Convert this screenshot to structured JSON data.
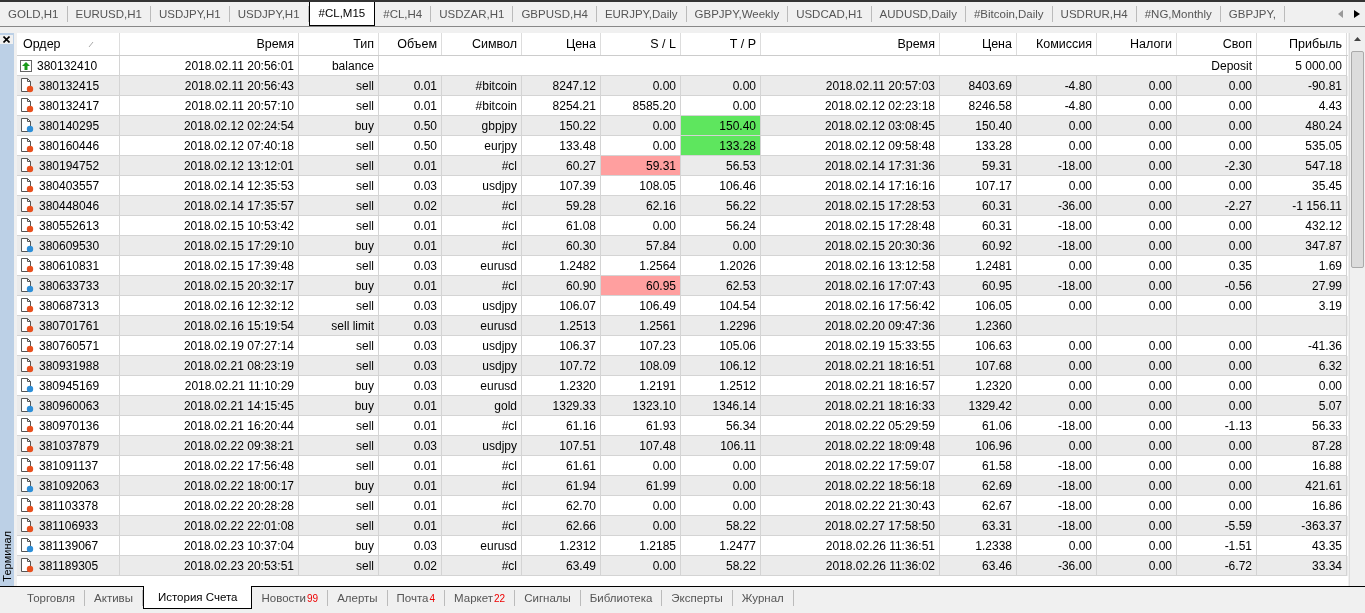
{
  "chart_tabs": [
    {
      "label": "GOLD,H1",
      "selected": false
    },
    {
      "label": "EURUSD,H1",
      "selected": false
    },
    {
      "label": "USDJPY,H1",
      "selected": false
    },
    {
      "label": "USDJPY,H1",
      "selected": false
    },
    {
      "label": "#CL,M15",
      "selected": true
    },
    {
      "label": "#CL,H4",
      "selected": false
    },
    {
      "label": "USDZAR,H1",
      "selected": false
    },
    {
      "label": "GBPUSD,H4",
      "selected": false
    },
    {
      "label": "EURJPY,Daily",
      "selected": false
    },
    {
      "label": "GBPJPY,Weekly",
      "selected": false
    },
    {
      "label": "USDCAD,H1",
      "selected": false
    },
    {
      "label": "AUDUSD,Daily",
      "selected": false
    },
    {
      "label": "#Bitcoin,Daily",
      "selected": false
    },
    {
      "label": "USDRUR,H4",
      "selected": false
    },
    {
      "label": "#NG,Monthly",
      "selected": false
    },
    {
      "label": "GBPJPY,",
      "selected": false
    }
  ],
  "panel_title": "Терминал",
  "columns": [
    "Ордер",
    "Время",
    "Тип",
    "Объем",
    "Символ",
    "Цена",
    "S / L",
    "T / P",
    "Время",
    "Цена",
    "Комиссия",
    "Налоги",
    "Своп",
    "Прибыль"
  ],
  "rows": [
    {
      "kind": "balance",
      "order": "380132410",
      "open_time": "2018.02.11 20:56:01",
      "type": "balance",
      "comment": "Deposit",
      "profit": "5 000.00"
    },
    {
      "kind": "sell",
      "order": "380132415",
      "open_time": "2018.02.11 20:56:43",
      "type": "sell",
      "volume": "0.01",
      "symbol": "#bitcoin",
      "price": "8247.12",
      "sl": "0.00",
      "tp": "0.00",
      "close_time": "2018.02.11 20:57:03",
      "close_price": "8403.69",
      "commission": "-4.80",
      "taxes": "0.00",
      "swap": "0.00",
      "profit": "-90.81",
      "sl_hit": false,
      "tp_hit": false
    },
    {
      "kind": "sell",
      "order": "380132417",
      "open_time": "2018.02.11 20:57:10",
      "type": "sell",
      "volume": "0.01",
      "symbol": "#bitcoin",
      "price": "8254.21",
      "sl": "8585.20",
      "tp": "0.00",
      "close_time": "2018.02.12 02:23:18",
      "close_price": "8246.58",
      "commission": "-4.80",
      "taxes": "0.00",
      "swap": "0.00",
      "profit": "4.43",
      "sl_hit": false,
      "tp_hit": false
    },
    {
      "kind": "buy",
      "order": "380140295",
      "open_time": "2018.02.12 02:24:54",
      "type": "buy",
      "volume": "0.50",
      "symbol": "gbpjpy",
      "price": "150.22",
      "sl": "0.00",
      "tp": "150.40",
      "close_time": "2018.02.12 03:08:45",
      "close_price": "150.40",
      "commission": "0.00",
      "taxes": "0.00",
      "swap": "0.00",
      "profit": "480.24",
      "sl_hit": false,
      "tp_hit": true
    },
    {
      "kind": "sell",
      "order": "380160446",
      "open_time": "2018.02.12 07:40:18",
      "type": "sell",
      "volume": "0.50",
      "symbol": "eurjpy",
      "price": "133.48",
      "sl": "0.00",
      "tp": "133.28",
      "close_time": "2018.02.12 09:58:48",
      "close_price": "133.28",
      "commission": "0.00",
      "taxes": "0.00",
      "swap": "0.00",
      "profit": "535.05",
      "sl_hit": false,
      "tp_hit": true
    },
    {
      "kind": "sell",
      "order": "380194752",
      "open_time": "2018.02.12 13:12:01",
      "type": "sell",
      "volume": "0.01",
      "symbol": "#cl",
      "price": "60.27",
      "sl": "59.31",
      "tp": "56.53",
      "close_time": "2018.02.14 17:31:36",
      "close_price": "59.31",
      "commission": "-18.00",
      "taxes": "0.00",
      "swap": "-2.30",
      "profit": "547.18",
      "sl_hit": true,
      "tp_hit": false
    },
    {
      "kind": "sell",
      "order": "380403557",
      "open_time": "2018.02.14 12:35:53",
      "type": "sell",
      "volume": "0.03",
      "symbol": "usdjpy",
      "price": "107.39",
      "sl": "108.05",
      "tp": "106.46",
      "close_time": "2018.02.14 17:16:16",
      "close_price": "107.17",
      "commission": "0.00",
      "taxes": "0.00",
      "swap": "0.00",
      "profit": "35.45",
      "sl_hit": false,
      "tp_hit": false
    },
    {
      "kind": "sell",
      "order": "380448046",
      "open_time": "2018.02.14 17:35:57",
      "type": "sell",
      "volume": "0.02",
      "symbol": "#cl",
      "price": "59.28",
      "sl": "62.16",
      "tp": "56.22",
      "close_time": "2018.02.15 17:28:53",
      "close_price": "60.31",
      "commission": "-36.00",
      "taxes": "0.00",
      "swap": "-2.27",
      "profit": "-1 156.11",
      "sl_hit": false,
      "tp_hit": false
    },
    {
      "kind": "sell",
      "order": "380552613",
      "open_time": "2018.02.15 10:53:42",
      "type": "sell",
      "volume": "0.01",
      "symbol": "#cl",
      "price": "61.08",
      "sl": "0.00",
      "tp": "56.24",
      "close_time": "2018.02.15 17:28:48",
      "close_price": "60.31",
      "commission": "-18.00",
      "taxes": "0.00",
      "swap": "0.00",
      "profit": "432.12",
      "sl_hit": false,
      "tp_hit": false
    },
    {
      "kind": "buy",
      "order": "380609530",
      "open_time": "2018.02.15 17:29:10",
      "type": "buy",
      "volume": "0.01",
      "symbol": "#cl",
      "price": "60.30",
      "sl": "57.84",
      "tp": "0.00",
      "close_time": "2018.02.15 20:30:36",
      "close_price": "60.92",
      "commission": "-18.00",
      "taxes": "0.00",
      "swap": "0.00",
      "profit": "347.87",
      "sl_hit": false,
      "tp_hit": false
    },
    {
      "kind": "sell",
      "order": "380610831",
      "open_time": "2018.02.15 17:39:48",
      "type": "sell",
      "volume": "0.03",
      "symbol": "eurusd",
      "price": "1.2482",
      "sl": "1.2564",
      "tp": "1.2026",
      "close_time": "2018.02.16 13:12:58",
      "close_price": "1.2481",
      "commission": "0.00",
      "taxes": "0.00",
      "swap": "0.35",
      "profit": "1.69",
      "sl_hit": false,
      "tp_hit": false
    },
    {
      "kind": "buy",
      "order": "380633733",
      "open_time": "2018.02.15 20:32:17",
      "type": "buy",
      "volume": "0.01",
      "symbol": "#cl",
      "price": "60.90",
      "sl": "60.95",
      "tp": "62.53",
      "close_time": "2018.02.16 17:07:43",
      "close_price": "60.95",
      "commission": "-18.00",
      "taxes": "0.00",
      "swap": "-0.56",
      "profit": "27.99",
      "sl_hit": true,
      "tp_hit": false
    },
    {
      "kind": "sell",
      "order": "380687313",
      "open_time": "2018.02.16 12:32:12",
      "type": "sell",
      "volume": "0.03",
      "symbol": "usdjpy",
      "price": "106.07",
      "sl": "106.49",
      "tp": "104.54",
      "close_time": "2018.02.16 17:56:42",
      "close_price": "106.05",
      "commission": "0.00",
      "taxes": "0.00",
      "swap": "0.00",
      "profit": "3.19",
      "sl_hit": false,
      "tp_hit": false
    },
    {
      "kind": "sell",
      "order": "380701761",
      "open_time": "2018.02.16 15:19:54",
      "type": "sell limit",
      "volume": "0.03",
      "symbol": "eurusd",
      "price": "1.2513",
      "sl": "1.2561",
      "tp": "1.2296",
      "close_time": "2018.02.20 09:47:36",
      "close_price": "1.2360",
      "sl_hit": false,
      "tp_hit": false
    },
    {
      "kind": "sell",
      "order": "380760571",
      "open_time": "2018.02.19 07:27:14",
      "type": "sell",
      "volume": "0.03",
      "symbol": "usdjpy",
      "price": "106.37",
      "sl": "107.23",
      "tp": "105.06",
      "close_time": "2018.02.19 15:33:55",
      "close_price": "106.63",
      "commission": "0.00",
      "taxes": "0.00",
      "swap": "0.00",
      "profit": "-41.36",
      "sl_hit": false,
      "tp_hit": false
    },
    {
      "kind": "sell",
      "order": "380931988",
      "open_time": "2018.02.21 08:23:19",
      "type": "sell",
      "volume": "0.03",
      "symbol": "usdjpy",
      "price": "107.72",
      "sl": "108.09",
      "tp": "106.12",
      "close_time": "2018.02.21 18:16:51",
      "close_price": "107.68",
      "commission": "0.00",
      "taxes": "0.00",
      "swap": "0.00",
      "profit": "6.32",
      "sl_hit": false,
      "tp_hit": false
    },
    {
      "kind": "buy",
      "order": "380945169",
      "open_time": "2018.02.21 11:10:29",
      "type": "buy",
      "volume": "0.03",
      "symbol": "eurusd",
      "price": "1.2320",
      "sl": "1.2191",
      "tp": "1.2512",
      "close_time": "2018.02.21 18:16:57",
      "close_price": "1.2320",
      "commission": "0.00",
      "taxes": "0.00",
      "swap": "0.00",
      "profit": "0.00",
      "sl_hit": false,
      "tp_hit": false
    },
    {
      "kind": "buy",
      "order": "380960063",
      "open_time": "2018.02.21 14:15:45",
      "type": "buy",
      "volume": "0.01",
      "symbol": "gold",
      "price": "1329.33",
      "sl": "1323.10",
      "tp": "1346.14",
      "close_time": "2018.02.21 18:16:33",
      "close_price": "1329.42",
      "commission": "0.00",
      "taxes": "0.00",
      "swap": "0.00",
      "profit": "5.07",
      "sl_hit": false,
      "tp_hit": false
    },
    {
      "kind": "sell",
      "order": "380970136",
      "open_time": "2018.02.21 16:20:44",
      "type": "sell",
      "volume": "0.01",
      "symbol": "#cl",
      "price": "61.16",
      "sl": "61.93",
      "tp": "56.34",
      "close_time": "2018.02.22 05:29:59",
      "close_price": "61.06",
      "commission": "-18.00",
      "taxes": "0.00",
      "swap": "-1.13",
      "profit": "56.33",
      "sl_hit": false,
      "tp_hit": false
    },
    {
      "kind": "sell",
      "order": "381037879",
      "open_time": "2018.02.22 09:38:21",
      "type": "sell",
      "volume": "0.03",
      "symbol": "usdjpy",
      "price": "107.51",
      "sl": "107.48",
      "tp": "106.11",
      "close_time": "2018.02.22 18:09:48",
      "close_price": "106.96",
      "commission": "0.00",
      "taxes": "0.00",
      "swap": "0.00",
      "profit": "87.28",
      "sl_hit": false,
      "tp_hit": false
    },
    {
      "kind": "sell",
      "order": "381091137",
      "open_time": "2018.02.22 17:56:48",
      "type": "sell",
      "volume": "0.01",
      "symbol": "#cl",
      "price": "61.61",
      "sl": "0.00",
      "tp": "0.00",
      "close_time": "2018.02.22 17:59:07",
      "close_price": "61.58",
      "commission": "-18.00",
      "taxes": "0.00",
      "swap": "0.00",
      "profit": "16.88",
      "sl_hit": false,
      "tp_hit": false
    },
    {
      "kind": "buy",
      "order": "381092063",
      "open_time": "2018.02.22 18:00:17",
      "type": "buy",
      "volume": "0.01",
      "symbol": "#cl",
      "price": "61.94",
      "sl": "61.99",
      "tp": "0.00",
      "close_time": "2018.02.22 18:56:18",
      "close_price": "62.69",
      "commission": "-18.00",
      "taxes": "0.00",
      "swap": "0.00",
      "profit": "421.61",
      "sl_hit": false,
      "tp_hit": false
    },
    {
      "kind": "sell",
      "order": "381103378",
      "open_time": "2018.02.22 20:28:28",
      "type": "sell",
      "volume": "0.01",
      "symbol": "#cl",
      "price": "62.70",
      "sl": "0.00",
      "tp": "0.00",
      "close_time": "2018.02.22 21:30:43",
      "close_price": "62.67",
      "commission": "-18.00",
      "taxes": "0.00",
      "swap": "0.00",
      "profit": "16.86",
      "sl_hit": false,
      "tp_hit": false
    },
    {
      "kind": "sell",
      "order": "381106933",
      "open_time": "2018.02.22 22:01:08",
      "type": "sell",
      "volume": "0.01",
      "symbol": "#cl",
      "price": "62.66",
      "sl": "0.00",
      "tp": "58.22",
      "close_time": "2018.02.27 17:58:50",
      "close_price": "63.31",
      "commission": "-18.00",
      "taxes": "0.00",
      "swap": "-5.59",
      "profit": "-363.37",
      "sl_hit": false,
      "tp_hit": false
    },
    {
      "kind": "buy",
      "order": "381139067",
      "open_time": "2018.02.23 10:37:04",
      "type": "buy",
      "volume": "0.03",
      "symbol": "eurusd",
      "price": "1.2312",
      "sl": "1.2185",
      "tp": "1.2477",
      "close_time": "2018.02.26 11:36:51",
      "close_price": "1.2338",
      "commission": "0.00",
      "taxes": "0.00",
      "swap": "-1.51",
      "profit": "43.35",
      "sl_hit": false,
      "tp_hit": false
    },
    {
      "kind": "sell",
      "order": "381189305",
      "open_time": "2018.02.23 20:53:51",
      "type": "sell",
      "volume": "0.02",
      "symbol": "#cl",
      "price": "63.49",
      "sl": "0.00",
      "tp": "58.22",
      "close_time": "2018.02.26 11:36:02",
      "close_price": "63.46",
      "commission": "-36.00",
      "taxes": "0.00",
      "swap": "-6.72",
      "profit": "33.34",
      "sl_hit": false,
      "tp_hit": false
    }
  ],
  "bottom_tabs": [
    {
      "label": "Торговля",
      "selected": false
    },
    {
      "label": "Активы",
      "selected": false
    },
    {
      "label": "История Счета",
      "selected": true
    },
    {
      "label": "Новости",
      "badge": "99",
      "selected": false
    },
    {
      "label": "Алерты",
      "selected": false
    },
    {
      "label": "Почта",
      "badge": "4",
      "selected": false
    },
    {
      "label": "Маркет",
      "badge": "22",
      "selected": false
    },
    {
      "label": "Сигналы",
      "selected": false
    },
    {
      "label": "Библиотека",
      "selected": false
    },
    {
      "label": "Эксперты",
      "selected": false
    },
    {
      "label": "Журнал",
      "selected": false
    }
  ]
}
